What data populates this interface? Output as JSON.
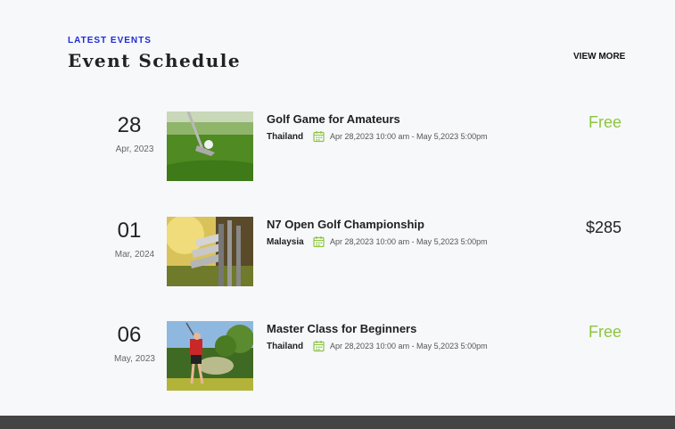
{
  "header": {
    "eyebrow": "LATEST EVENTS",
    "title": "Event Schedule",
    "view_more": "VIEW MORE"
  },
  "events": [
    {
      "day": "28",
      "month": "Apr, 2023",
      "title": "Golf Game for Amateurs",
      "location": "Thailand",
      "when": "Apr 28,2023 10:00 am - May 5,2023 5:00pm",
      "price": "Free"
    },
    {
      "day": "01",
      "month": "Mar, 2024",
      "title": "N7 Open Golf Championship",
      "location": "Malaysia",
      "when": "Apr 28,2023 10:00 am - May 5,2023 5:00pm",
      "price": "$285"
    },
    {
      "day": "06",
      "month": "May, 2023",
      "title": "Master Class for Beginners",
      "location": "Thailand",
      "when": "Apr 28,2023 10:00 am - May 5,2023 5:00pm",
      "price": "Free"
    }
  ],
  "colors": {
    "accent_blue": "#1e2bd6",
    "free_green": "#8cc63f",
    "background": "#f7f8fa",
    "footer": "#444444"
  }
}
